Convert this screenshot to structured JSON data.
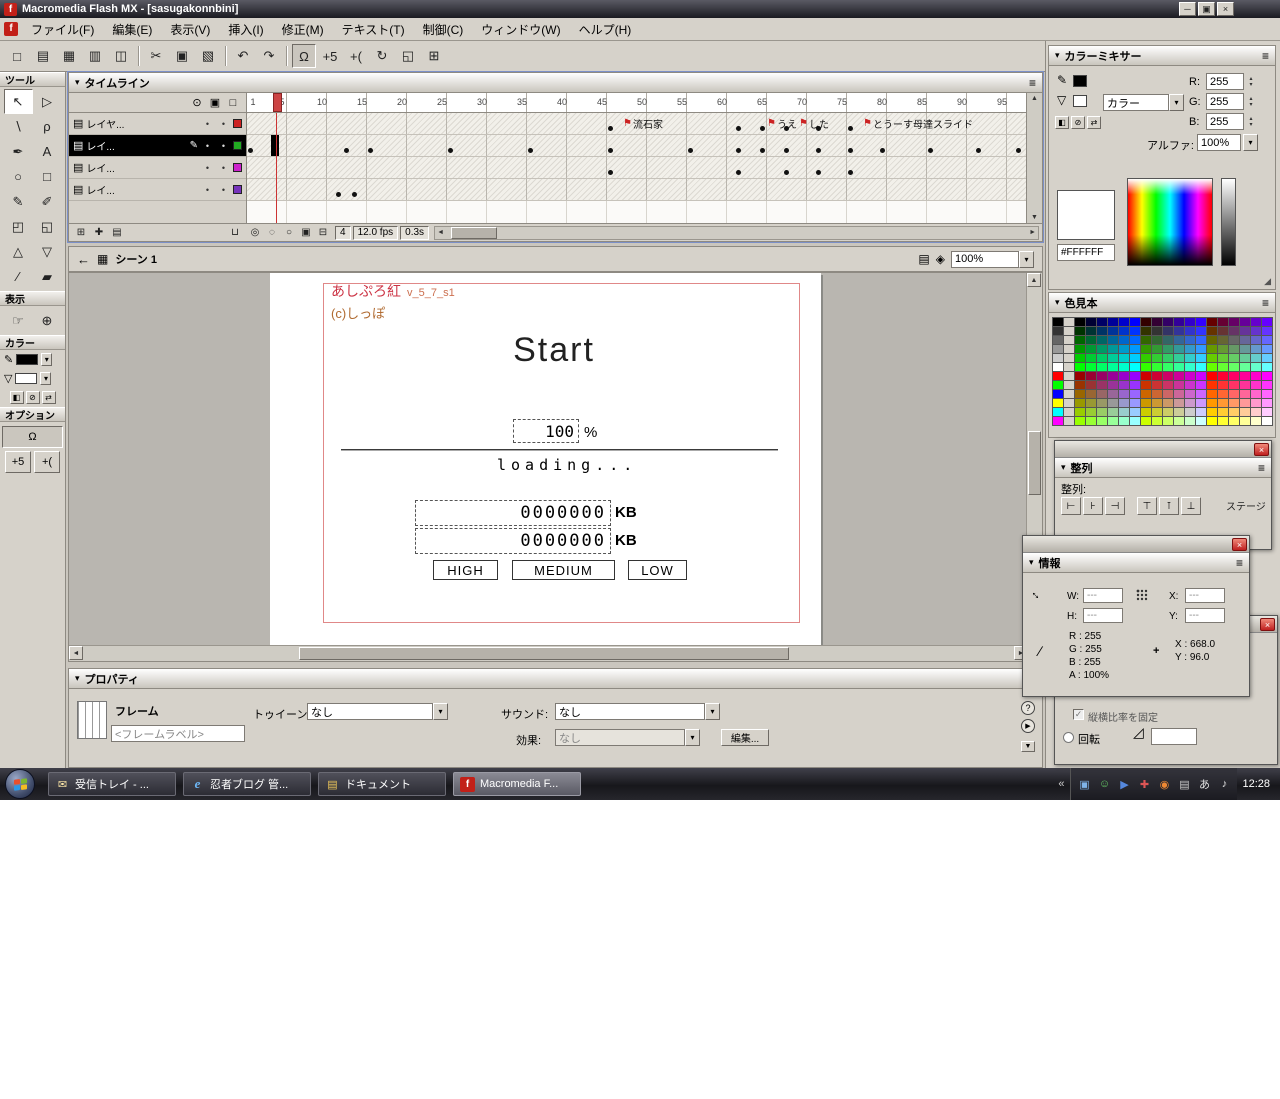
{
  "colors": {
    "panel_bg": "#d6d2ca",
    "selection": "#000000",
    "playhead_red": "#cc2222",
    "stage_outline_red": "#e08888",
    "stage_title_red": "#cc3344",
    "stage_version_orange": "#cc7050",
    "stage_copyright_brown": "#b06a30",
    "current_color_hex": "#FFFFFF"
  },
  "titlebar": {
    "title": "Macromedia Flash MX - [sasugakonnbini]",
    "app_icon_letter": "f",
    "minimize_glyph": "─",
    "restore_glyph": "▣",
    "close_glyph": "×"
  },
  "menubar": {
    "items": [
      "ファイル(F)",
      "編集(E)",
      "表示(V)",
      "挿入(I)",
      "修正(M)",
      "テキスト(T)",
      "制御(C)",
      "ウィンドウ(W)",
      "ヘルプ(H)"
    ]
  },
  "toolbar": {
    "icons": [
      {
        "name": "new-document-icon",
        "glyph": "□"
      },
      {
        "name": "open-icon",
        "glyph": "▤"
      },
      {
        "name": "save-icon",
        "glyph": "▦"
      },
      {
        "name": "print-icon",
        "glyph": "▥"
      },
      {
        "name": "print-preview-icon",
        "glyph": "◫"
      },
      {
        "name": "cut-icon",
        "glyph": "✂"
      },
      {
        "name": "copy-icon",
        "glyph": "▣"
      },
      {
        "name": "paste-icon",
        "glyph": "▧"
      },
      {
        "name": "undo-icon",
        "glyph": "↶"
      },
      {
        "name": "redo-icon",
        "glyph": "↷"
      },
      {
        "name": "snap-magnet-icon",
        "glyph": "Ω",
        "active": true
      },
      {
        "name": "smooth-icon",
        "glyph": "+5"
      },
      {
        "name": "straighten-icon",
        "glyph": "+("
      },
      {
        "name": "rotate-icon",
        "glyph": "↻"
      },
      {
        "name": "scale-icon",
        "glyph": "◱"
      },
      {
        "name": "align-icon",
        "glyph": "⊞"
      }
    ]
  },
  "tools_panel": {
    "title": "ツール",
    "tools": [
      {
        "name": "arrow-tool",
        "glyph": "↖",
        "active": true
      },
      {
        "name": "subselection-tool",
        "glyph": "▷"
      },
      {
        "name": "line-tool",
        "glyph": "∖"
      },
      {
        "name": "lasso-tool",
        "glyph": "ρ"
      },
      {
        "name": "pen-tool",
        "glyph": "✒"
      },
      {
        "name": "text-tool",
        "glyph": "A"
      },
      {
        "name": "oval-tool",
        "glyph": "○"
      },
      {
        "name": "rectangle-tool",
        "glyph": "□"
      },
      {
        "name": "pencil-tool",
        "glyph": "✎"
      },
      {
        "name": "brush-tool",
        "glyph": "✐"
      },
      {
        "name": "free-transform-tool",
        "glyph": "◰"
      },
      {
        "name": "fill-transform-tool",
        "glyph": "◱"
      },
      {
        "name": "ink-bottle-tool",
        "glyph": "△"
      },
      {
        "name": "paint-bucket-tool",
        "glyph": "▽"
      },
      {
        "name": "eyedropper-tool",
        "glyph": "∕"
      },
      {
        "name": "eraser-tool",
        "glyph": "▰"
      }
    ],
    "section_view": "表示",
    "view_tools": [
      {
        "name": "hand-tool",
        "glyph": "☞"
      },
      {
        "name": "zoom-tool",
        "glyph": "⊕"
      }
    ],
    "section_colors": "カラー",
    "stroke_icon_glyph": "✎",
    "fill_icon_glyph": "▽",
    "stroke_color": "#000000",
    "fill_color": "#ffffff",
    "color_buttons": [
      {
        "name": "default-colors-icon",
        "glyph": "◧"
      },
      {
        "name": "no-color-icon",
        "glyph": "⊘"
      },
      {
        "name": "swap-colors-icon",
        "glyph": "⇄"
      }
    ],
    "section_options": "オプション",
    "option_buttons": [
      {
        "name": "snap-option-icon",
        "glyph": "Ω",
        "active": true
      },
      {
        "name": "smooth-option-icon",
        "glyph": "+5"
      },
      {
        "name": "straighten-option-icon",
        "glyph": "+("
      }
    ]
  },
  "timeline": {
    "title": "タイムライン",
    "header_icons": [
      {
        "name": "show-hide-layers-icon",
        "glyph": "⊙"
      },
      {
        "name": "lock-layers-icon",
        "glyph": "▣"
      },
      {
        "name": "outline-layers-icon",
        "glyph": "□"
      }
    ],
    "layers": [
      {
        "name": "レイヤ...",
        "color": "#cc2222",
        "selected": false,
        "keyframes": [
          46,
          62,
          65,
          68,
          72,
          76
        ]
      },
      {
        "name": "レイ...",
        "color": "#22aa22",
        "selected": true,
        "keyframes": [
          1,
          13,
          16,
          26,
          36,
          46,
          56,
          62,
          65,
          68,
          72,
          76,
          80,
          86,
          92,
          97
        ]
      },
      {
        "name": "レイ...",
        "color": "#cc22cc",
        "selected": false,
        "keyframes": [
          46,
          62,
          68,
          72,
          76
        ]
      },
      {
        "name": "レイ...",
        "color": "#7733bb",
        "selected": false,
        "keyframes": [
          12,
          14
        ]
      }
    ],
    "frame_labels": [
      {
        "text": "流石家",
        "frame": 48
      },
      {
        "text": "うえ",
        "frame": 66
      },
      {
        "text": "した",
        "frame": 70
      },
      {
        "text": "とうーす母達スライド",
        "frame": 78
      }
    ],
    "ruler": [
      1,
      5,
      10,
      15,
      20,
      25,
      30,
      35,
      40,
      45,
      50,
      55,
      60,
      65,
      70,
      75,
      80,
      85,
      90,
      95
    ],
    "playhead_frame": 4,
    "layer_strip_icons": [
      {
        "name": "insert-layer-icon",
        "glyph": "⊞"
      },
      {
        "name": "add-guide-layer-icon",
        "glyph": "✚"
      },
      {
        "name": "insert-layer-folder-icon",
        "glyph": "▤"
      }
    ],
    "delete_layer_glyph": "⊔",
    "status_icons": [
      {
        "name": "center-frame-icon",
        "glyph": "◎"
      },
      {
        "name": "onion-skin-icon",
        "glyph": "◌"
      },
      {
        "name": "onion-skin-outlines-icon",
        "glyph": "○"
      },
      {
        "name": "edit-multiple-frames-icon",
        "glyph": "▣"
      },
      {
        "name": "modify-onion-markers-icon",
        "glyph": "⊟"
      }
    ],
    "current_frame": "4",
    "frame_rate": "12.0 fps",
    "elapsed_time": "0.3s"
  },
  "scene_bar": {
    "scene_name": "シーン 1",
    "zoom_value": "100%"
  },
  "stage": {
    "title_text": "あしぷろ紅",
    "version_text": "v_5_7_s1",
    "copyright_text": "(c)しっぽ",
    "start_text": "Start",
    "percent_value": "100",
    "percent_unit": "%",
    "loading_text": "loading...",
    "kb_value_top": "0000000",
    "kb_value_bottom": "0000000",
    "kb_unit_top": "KB",
    "kb_unit_bottom": "KB",
    "quality_buttons": [
      "HIGH",
      "MEDIUM",
      "LOW"
    ]
  },
  "properties": {
    "title": "プロパティ",
    "frame_type_label": "フレーム",
    "frame_name_placeholder": "<フレームラベル>",
    "tween_label": "トゥイーン:",
    "tween_value": "なし",
    "sound_label": "サウンド:",
    "sound_value": "なし",
    "effect_label": "効果:",
    "effect_value": "なし",
    "edit_button_label": "編集..."
  },
  "color_mixer": {
    "title": "カラーミキサー",
    "fill_style_label": "カラー",
    "r_label": "R:",
    "r_value": "255",
    "g_label": "G:",
    "g_value": "255",
    "b_label": "B:",
    "b_value": "255",
    "alpha_label": "アルファ:",
    "alpha_value": "100%",
    "hex_value": "#FFFFFF"
  },
  "swatches": {
    "title": "色見本",
    "basic_column": [
      "#000000",
      "#333333",
      "#666666",
      "#999999",
      "#cccccc",
      "#ffffff",
      "#ff0000",
      "#00ff00",
      "#0000ff",
      "#ffff00",
      "#00ffff",
      "#ff00ff"
    ],
    "grid_rows": 12,
    "grid_cols": 20
  },
  "align_panel": {
    "title": "整列",
    "align_label": "整列:",
    "stage_label": "ステージ",
    "close_glyph": "×",
    "buttons": [
      {
        "name": "align-left-button",
        "glyph": "⊢"
      },
      {
        "name": "align-h-center-button",
        "glyph": "⊦"
      },
      {
        "name": "align-right-button",
        "glyph": "⊣"
      },
      {
        "name": "align-top-button",
        "glyph": "⊤"
      },
      {
        "name": "align-v-center-button",
        "glyph": "⊺"
      },
      {
        "name": "align-bottom-button",
        "glyph": "⊥"
      }
    ]
  },
  "info_panel": {
    "title": "情報",
    "close_glyph": "×",
    "w_label": "W:",
    "w_value": "---",
    "h_label": "H:",
    "h_value": "---",
    "x_label": "X:",
    "x_value": "---",
    "y_label": "Y:",
    "y_value": "---",
    "rgb_lines": [
      "R : 255",
      "G : 255",
      "B : 255",
      "A : 100%"
    ],
    "plus_glyph": "+",
    "pos_lines": [
      "X : 668.0",
      "Y : 96.0"
    ]
  },
  "transform_panel": {
    "close_glyph": "×",
    "constrain_label": "縦横比率を固定",
    "rotate_label": "回転",
    "skew_glyph": "◿"
  },
  "taskbar": {
    "tasks": [
      {
        "label": "受信トレイ - ...",
        "icon": "mail",
        "active": false
      },
      {
        "label": "忍者ブログ 管...",
        "icon": "ie",
        "active": false
      },
      {
        "label": "ドキュメント",
        "icon": "folder",
        "active": false
      },
      {
        "label": "Macromedia F...",
        "icon": "flash",
        "active": true
      }
    ],
    "chevron_glyph": "«",
    "tray_icons": [
      {
        "name": "tray-display-icon",
        "color": "#7fb3e8",
        "glyph": "▣"
      },
      {
        "name": "tray-messenger-icon",
        "color": "#66cc66",
        "glyph": "☺"
      },
      {
        "name": "tray-media-icon",
        "color": "#5588dd",
        "glyph": "▶"
      },
      {
        "name": "tray-security-icon",
        "color": "#dd5555",
        "glyph": "✚"
      },
      {
        "name": "tray-firefox-icon",
        "color": "#ee8833",
        "glyph": "◉"
      },
      {
        "name": "tray-printer-icon",
        "color": "#cccccc",
        "glyph": "▤"
      },
      {
        "name": "tray-ime-icon",
        "color": "#e0e0e0",
        "glyph": "あ"
      },
      {
        "name": "tray-volume-icon",
        "color": "#e0e0e0",
        "glyph": "♪"
      }
    ],
    "clock": "12:28"
  }
}
